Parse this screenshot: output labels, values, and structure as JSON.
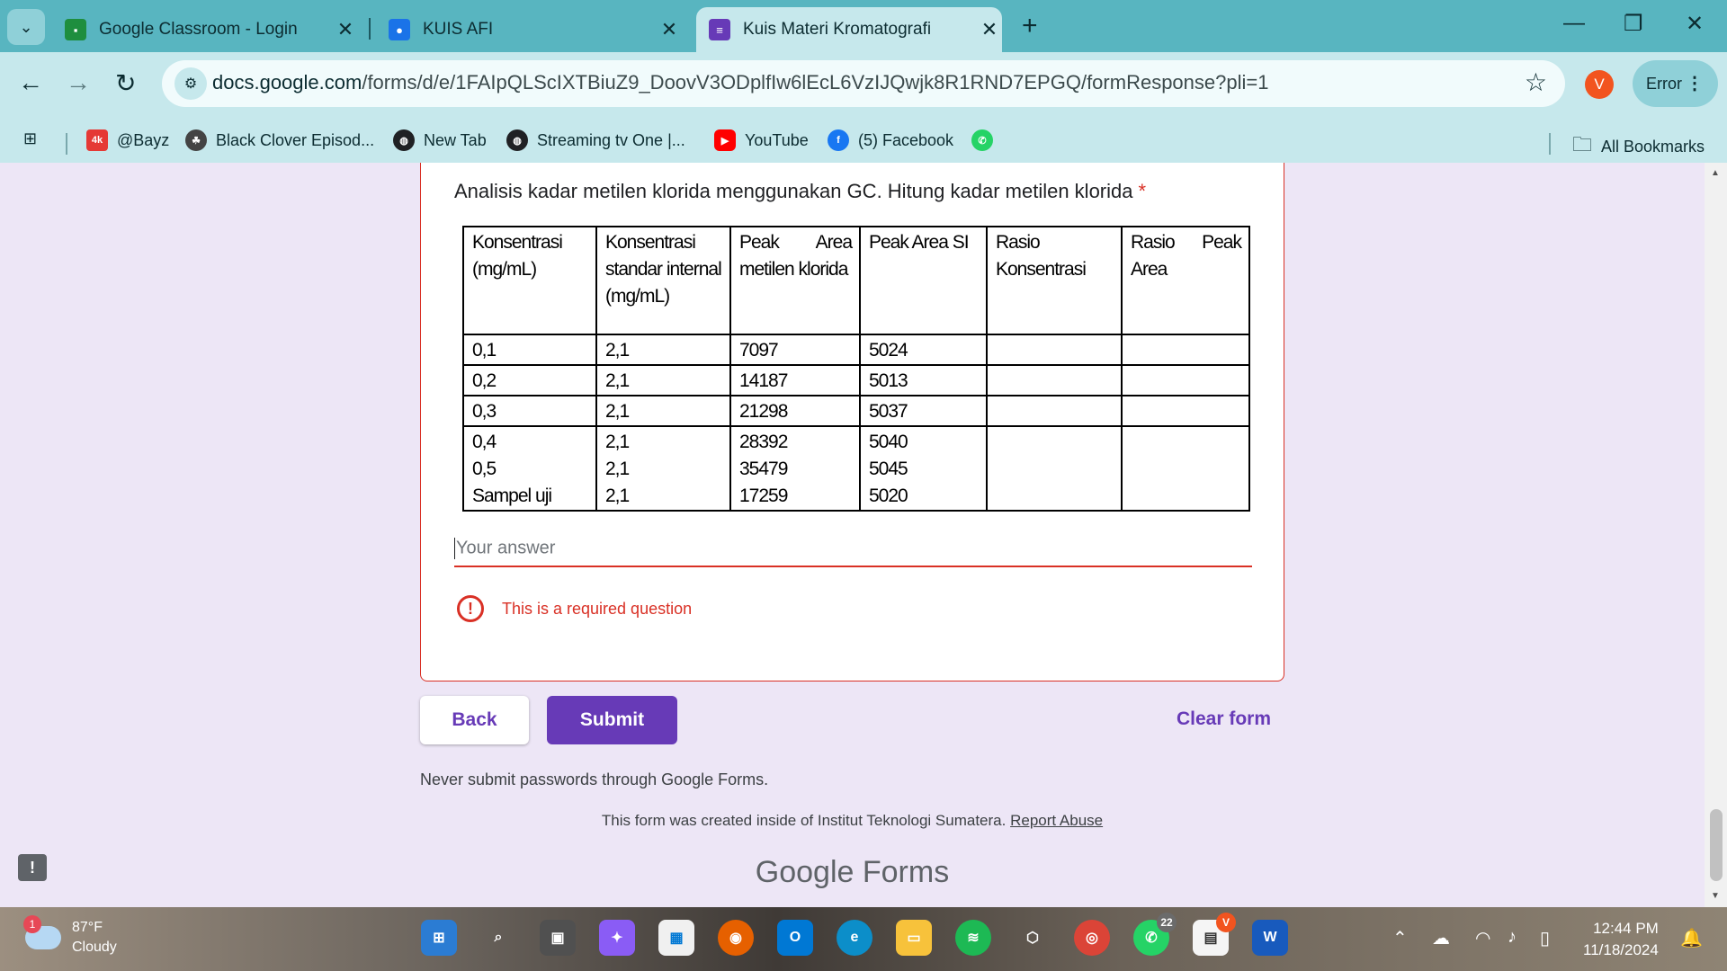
{
  "browser": {
    "tabs": [
      {
        "label": "Google Classroom - Login",
        "close": "✕"
      },
      {
        "label": "KUIS AFI",
        "close": "✕"
      },
      {
        "label": "Kuis Materi Kromatografi",
        "close": "✕"
      }
    ],
    "new_tab": "+",
    "window": {
      "minimize": "—",
      "restore": "❐",
      "close": "✕"
    },
    "url_host": "docs.google.com",
    "url_path": "/forms/d/e/1FAIpQLScIXTBiuZ9_DoovV3ODplfIw6lEcL6VzIJQwjk8R1RND7EPGQ/formResponse?pli=1",
    "profile_initial": "V",
    "error_label": "Error",
    "bookmarks": [
      {
        "label": "@Bayz",
        "icon": "4k-icon",
        "color": "#e53935"
      },
      {
        "label": "Black Clover Episod...",
        "icon": "clover-icon",
        "color": "#444444"
      },
      {
        "label": "New Tab",
        "icon": "globe-icon",
        "color": "#202124"
      },
      {
        "label": "Streaming tv One |...",
        "icon": "globe-icon",
        "color": "#202124"
      },
      {
        "label": "YouTube",
        "icon": "youtube-icon",
        "color": "#ff0000"
      },
      {
        "label": "(5) Facebook",
        "icon": "facebook-icon",
        "color": "#1877f2"
      },
      {
        "label": "",
        "icon": "whatsapp-icon",
        "color": "#25d366"
      }
    ],
    "all_bookmarks": "All Bookmarks"
  },
  "form": {
    "question": "Analisis kadar metilen klorida menggunakan GC. Hitung kadar metilen klorida",
    "required_mark": "*",
    "table": {
      "headers": [
        "Konsentrasi (mg/mL)",
        "Konsentrasi standar internal (mg/mL)",
        [
          "Peak",
          "Area"
        ],
        "Peak Area SI",
        "Rasio Konsentrasi",
        [
          "Rasio",
          "Peak"
        ]
      ],
      "header_line2": {
        "col3": "metilen klorida",
        "col6": "Area"
      },
      "rows": [
        [
          "0,1",
          "2,1",
          "7097",
          "5024"
        ],
        [
          "0,2",
          "2,1",
          "14187",
          "5013"
        ],
        [
          "0,3",
          "2,1",
          "21298",
          "5037"
        ]
      ],
      "block_rows": [
        [
          "0,4",
          "2,1",
          "28392",
          "5040"
        ],
        [
          "0,5",
          "2,1",
          "35479",
          "5045"
        ],
        [
          "Sampel uji",
          "2,1",
          "17259",
          "5020"
        ]
      ]
    },
    "answer_placeholder": "Your answer",
    "error_message": "This is a required question",
    "back_label": "Back",
    "submit_label": "Submit",
    "clear_label": "Clear form",
    "never_submit": "Never submit passwords through Google Forms.",
    "created_text": "This form was created inside of Institut Teknologi Sumatera.",
    "report_abuse": "Report Abuse",
    "footer_brand_google": "Google",
    "footer_brand_forms": "Forms"
  },
  "taskbar": {
    "weather_temp": "87°F",
    "weather_desc": "Cloudy",
    "weather_badge": "1",
    "whatsapp_badge": "22",
    "vivaldi_badge": "V",
    "time": "12:44 PM",
    "date": "11/18/2024"
  }
}
